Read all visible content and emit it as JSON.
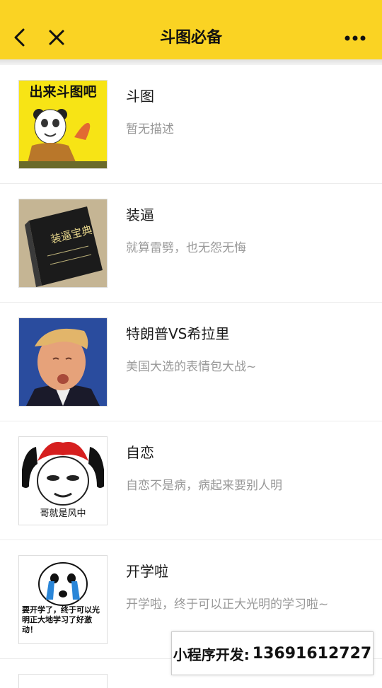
{
  "header": {
    "title": "斗图必备",
    "background_color": "#fad323",
    "icons": {
      "back": "back-icon",
      "close": "close-icon",
      "more": "more-icon"
    }
  },
  "items": [
    {
      "title": "斗图",
      "description": "暂无描述",
      "thumb_caption": "出来斗图吧"
    },
    {
      "title": "装逼",
      "description": "就算雷劈，也无怨无悔",
      "thumb_caption": "装逼宝典"
    },
    {
      "title": "特朗普VS希拉里",
      "description": "美国大选的表情包大战~"
    },
    {
      "title": "自恋",
      "description": "自恋不是病，病起来要别人明",
      "thumb_caption": "哥就是风中"
    },
    {
      "title": "开学啦",
      "description": "开学啦，终于可以正大光明的学习啦~",
      "thumb_caption": "要开学了，终于可以光明正大地学习了好激动！"
    }
  ],
  "contact": {
    "label": "小程序开发:",
    "phone": "13691612727"
  }
}
